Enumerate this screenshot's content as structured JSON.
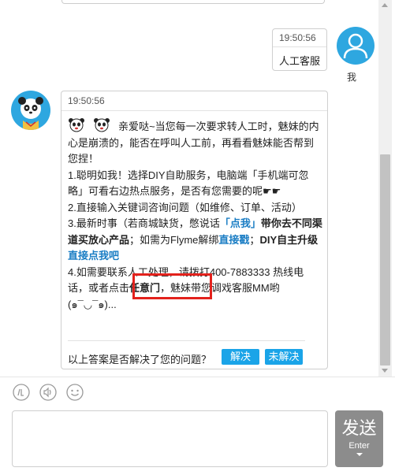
{
  "user_message": {
    "time": "19:50:56",
    "text": "人工客服",
    "sender_name": "我"
  },
  "bot_message": {
    "time": "19:50:56",
    "line_intro": "亲爱哒~当您每一次要求转人工时，魅妹的内心是崩溃的，能否在呼叫人工前，再看看魅妹能否帮到您捏！",
    "item1": "1.聪明如我！选择DIY自助服务，电脑端「手机端可忽略」可看右边热点服务，是否有您需要的呢☛☛",
    "item2": "2.直接输入关键词咨询问题（如维修、订单、活动）",
    "item3_a": "3.最新时事（若商城缺货，憋说话",
    "item3_link1": "「点我」",
    "item3_b": "带你去不同渠道买放心产品",
    "item3_c": "；如需为Flyme解绑",
    "item3_link2": "直接戳",
    "item3_d": "；",
    "item3_e": "DIY自主升级",
    "item3_link3": "直接点我吧",
    "item4_a": "4.如需要联系人工处理，请拨打400-7883333 热线电话，或者点击",
    "item4_b": "任意门",
    "item4_c": "，魅妹带您调戏客服MM哟(๑¯◡¯๑)...",
    "feedback_question": "以上答案是否解决了您的问题？",
    "solved_label": "解决",
    "unsolved_label": "未解决"
  },
  "input": {
    "placeholder": "",
    "value": ""
  },
  "send_button": {
    "label": "发送",
    "hint": "Enter"
  },
  "colors": {
    "accent": "#1aa4e8",
    "avatar_bg": "#2ea7e0",
    "highlight": "#e3211c",
    "link": "#1a7dc4",
    "send_bg": "#8c8c8c"
  },
  "toolbar_icons": [
    "smiley-icon",
    "sound-icon",
    "emoji-icon"
  ]
}
